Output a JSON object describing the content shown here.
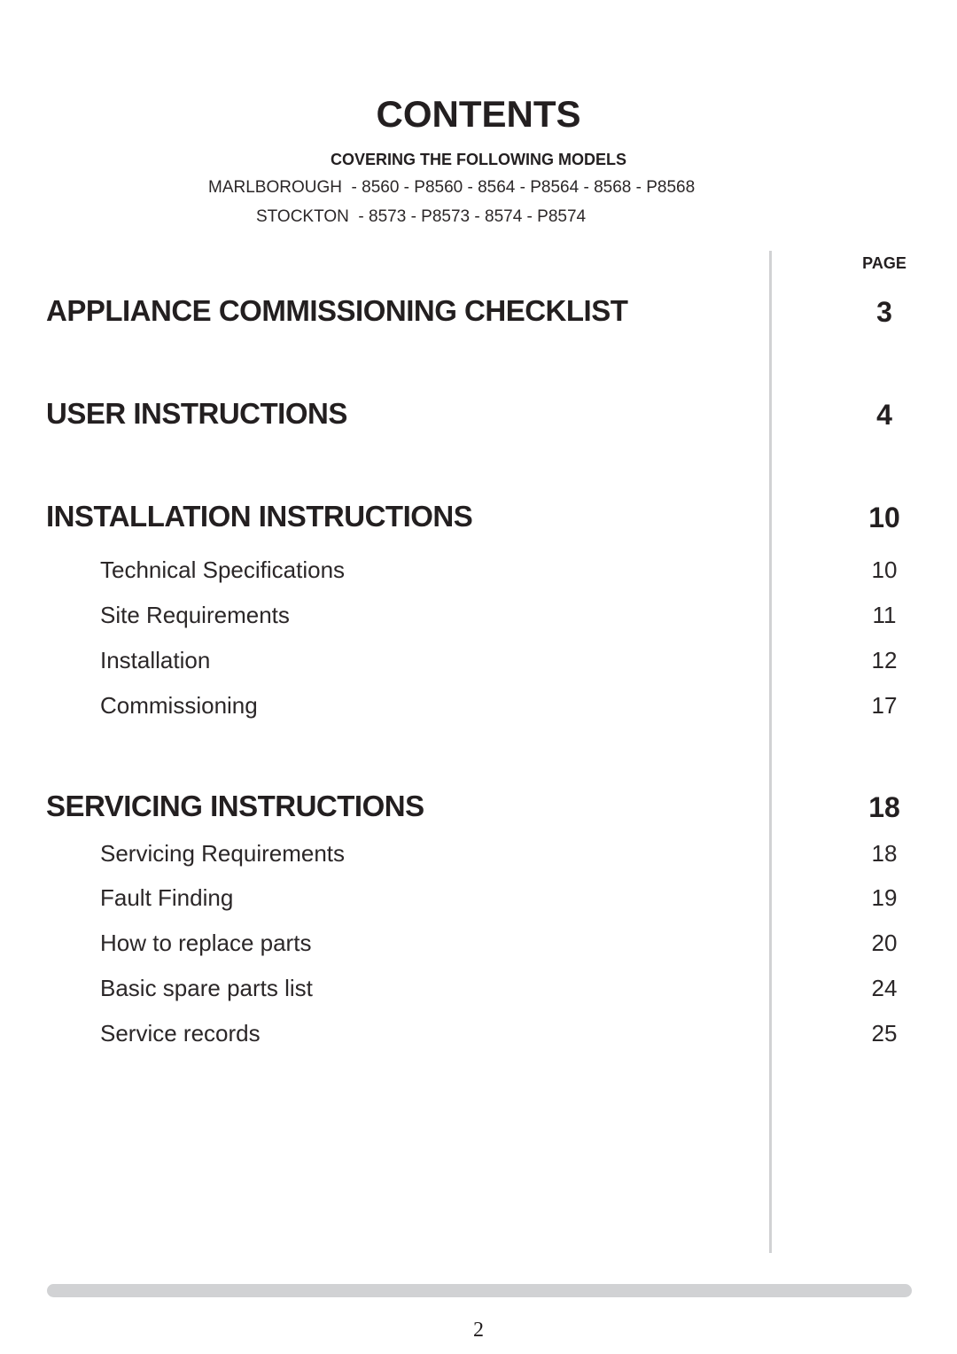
{
  "document": {
    "title": "CONTENTS",
    "covering_label": "COVERING THE FOLLOWING MODELS",
    "models": [
      "MARLBOROUGH  - 8560 - P8560 - 8564 - P8564 - 8568 - P8568",
      "STOCKTON  - 8573 - P8573 - 8574 - P8574"
    ],
    "page_column_header": "PAGE",
    "page_number": "2",
    "colors": {
      "text": "#231f20",
      "divider": "#d1d2d4",
      "footer_bar": "#d1d2d4"
    }
  },
  "sections": [
    {
      "title": "APPLIANCE COMMISSIONING CHECKLIST",
      "page": "3",
      "items": []
    },
    {
      "title": "USER INSTRUCTIONS",
      "page": "4",
      "items": []
    },
    {
      "title": "INSTALLATION INSTRUCTIONS",
      "page": "10",
      "items": [
        {
          "label": "Technical Specifications",
          "page": "10"
        },
        {
          "label": "Site Requirements",
          "page": "11"
        },
        {
          "label": "Installation",
          "page": "12"
        },
        {
          "label": "Commissioning",
          "page": "17"
        }
      ]
    },
    {
      "title": "SERVICING INSTRUCTIONS",
      "page": "18",
      "items": [
        {
          "label": "Servicing Requirements",
          "page": "18"
        },
        {
          "label": "Fault Finding",
          "page": "19"
        },
        {
          "label": "How to replace parts",
          "page": "20"
        },
        {
          "label": "Basic spare parts list",
          "page": "24"
        },
        {
          "label": "Service records",
          "page": "25"
        }
      ]
    }
  ]
}
